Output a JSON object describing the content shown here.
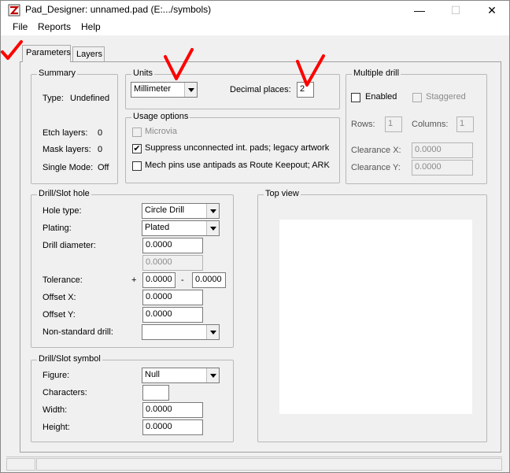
{
  "window": {
    "title": "Pad_Designer: unnamed.pad (E:.../symbols)",
    "minimize_glyph": "—",
    "maximize_glyph": "☐",
    "close_glyph": "✕"
  },
  "menu": {
    "file": "File",
    "reports": "Reports",
    "help": "Help"
  },
  "tabs": {
    "parameters": "Parameters",
    "layers": "Layers"
  },
  "summary": {
    "title": "Summary",
    "type_label": "Type:",
    "type_value": "Undefined",
    "etch_label": "Etch layers:",
    "etch_value": "0",
    "mask_label": "Mask layers:",
    "mask_value": "0",
    "single_label": "Single Mode:",
    "single_value": "Off"
  },
  "units": {
    "title": "Units",
    "selected": "Millimeter",
    "decimal_label": "Decimal places:",
    "decimal_value": "2"
  },
  "usage": {
    "title": "Usage options",
    "microvia": "Microvia",
    "suppress": "Suppress unconnected int. pads; legacy artwork",
    "mech": "Mech pins use antipads as Route Keepout; ARK",
    "check_mark": "✔"
  },
  "multiple_drill": {
    "title": "Multiple drill",
    "enabled": "Enabled",
    "staggered": "Staggered",
    "rows_label": "Rows:",
    "rows_value": "1",
    "columns_label": "Columns:",
    "columns_value": "1",
    "clearance_x_label": "Clearance X:",
    "clearance_x_value": "0.0000",
    "clearance_y_label": "Clearance Y:",
    "clearance_y_value": "0.0000"
  },
  "drill_hole": {
    "title": "Drill/Slot hole",
    "hole_type_label": "Hole type:",
    "hole_type_value": "Circle Drill",
    "plating_label": "Plating:",
    "plating_value": "Plated",
    "diameter_label": "Drill diameter:",
    "diameter_value": "0.0000",
    "diameter2_value": "0.0000",
    "tolerance_label": "Tolerance:",
    "plus": "+",
    "minus": "-",
    "tol_plus_value": "0.0000",
    "tol_minus_value": "0.0000",
    "offset_x_label": "Offset X:",
    "offset_x_value": "0.0000",
    "offset_y_label": "Offset Y:",
    "offset_y_value": "0.0000",
    "nonstd_label": "Non-standard drill:",
    "nonstd_value": ""
  },
  "drill_symbol": {
    "title": "Drill/Slot symbol",
    "figure_label": "Figure:",
    "figure_value": "Null",
    "characters_label": "Characters:",
    "characters_value": "",
    "width_label": "Width:",
    "width_value": "0.0000",
    "height_label": "Height:",
    "height_value": "0.0000"
  },
  "top_view": {
    "title": "Top view"
  },
  "colors": {
    "annotation": "#ff0000"
  }
}
